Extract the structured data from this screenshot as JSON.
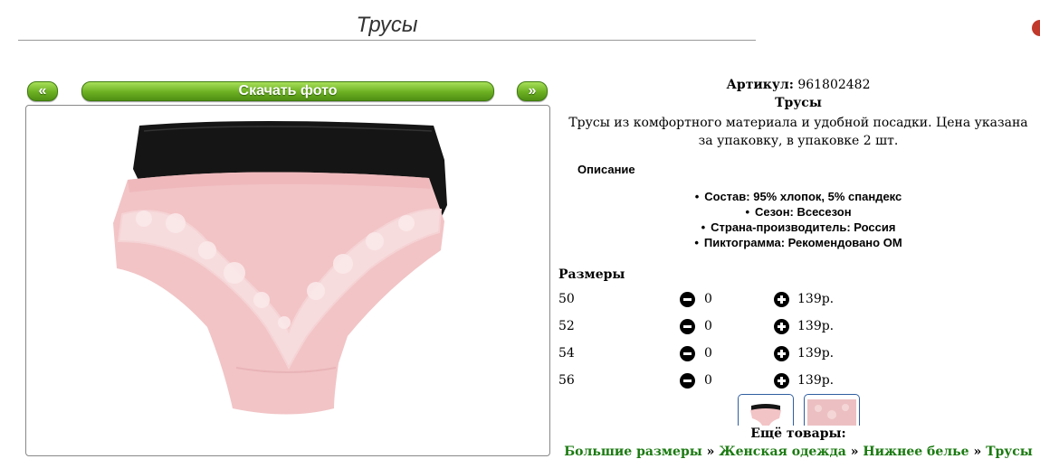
{
  "page": {
    "title": "Трусы"
  },
  "gallery": {
    "prev_label": "«",
    "download_label": "Скачать фото",
    "next_label": "»"
  },
  "product": {
    "article_label": "Артикул:",
    "article": "961802482",
    "name": "Трусы",
    "description": "Трусы из комфортного материала и удобной посадки. Цена указана за упаковку, в упаковке 2 шт.",
    "details_heading": "Описание",
    "properties": [
      "Состав: 95% хлопок, 5% спандекс",
      "Сезон: Всесезон",
      "Страна-производитель: Россия",
      "Пиктограмма: Рекомендовано ОМ"
    ]
  },
  "sizes": {
    "heading": "Размеры",
    "rows": [
      {
        "size": "50",
        "qty": "0",
        "price": "139р."
      },
      {
        "size": "52",
        "qty": "0",
        "price": "139р."
      },
      {
        "size": "54",
        "qty": "0",
        "price": "139р."
      },
      {
        "size": "56",
        "qty": "0",
        "price": "139р."
      }
    ]
  },
  "more": {
    "label": "Ещё товары:",
    "breadcrumbs": [
      "Большие размеры",
      "Женская одежда",
      "Нижнее белье",
      "Трусы"
    ],
    "separator": "»"
  },
  "colors": {
    "green_button": "#6cb022",
    "link_green": "#1a7a10",
    "panty_pink": "#f2c4c6",
    "panty_black": "#151515"
  }
}
